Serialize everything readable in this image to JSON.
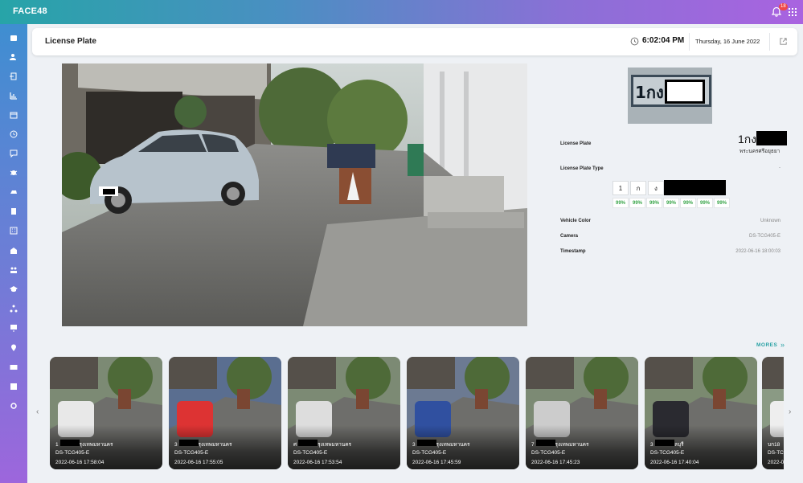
{
  "app": {
    "brand": "FACE48",
    "notification_count": "18"
  },
  "header": {
    "title": "License Plate",
    "time": "6:02:04 PM",
    "date": "Thursday, 16 June 2022"
  },
  "sidebar": {
    "items": [
      {
        "icon": "person-card-icon"
      },
      {
        "icon": "user-add-icon"
      },
      {
        "icon": "login-icon"
      },
      {
        "icon": "bar-chart-icon"
      },
      {
        "icon": "calendar-icon"
      },
      {
        "icon": "clock-icon"
      },
      {
        "icon": "message-icon"
      },
      {
        "icon": "bug-icon"
      },
      {
        "icon": "car-icon"
      },
      {
        "icon": "document-icon"
      },
      {
        "icon": "building-icon"
      },
      {
        "icon": "city-icon"
      },
      {
        "icon": "people-icon"
      },
      {
        "icon": "graduation-icon"
      },
      {
        "icon": "sitemap-icon"
      },
      {
        "icon": "monitor-icon"
      },
      {
        "icon": "location-pin-icon"
      },
      {
        "icon": "id-card-icon"
      },
      {
        "icon": "report-icon"
      },
      {
        "icon": "settings-icon"
      }
    ]
  },
  "detail": {
    "plate_prefix": "1กง",
    "province": "พระนครศรีอยุธยา",
    "labels": {
      "license_plate": "License Plate",
      "license_plate_type": "License Plate Type",
      "vehicle_color": "Vehicle Color",
      "camera": "Camera",
      "timestamp": "Timestamp"
    },
    "license_plate_type": "-",
    "vehicle_color": "Unknown",
    "camera": "DS-TCG405-E",
    "timestamp": "2022-06-16 18:00:03",
    "characters": [
      "1",
      "ก",
      "ง"
    ],
    "confidences": [
      "99%",
      "99%",
      "99%",
      "99%",
      "99%",
      "99%",
      "99%"
    ]
  },
  "mores_label": "MORES",
  "history": [
    {
      "plate_prefix": "1",
      "province": "กรุงเทพมหานคร",
      "camera": "DS-TCG405-E",
      "time": "2022-06-16 17:58:04"
    },
    {
      "plate_prefix": "3",
      "province": "กรุงเทพมหานคร",
      "camera": "DS-TCG405-E",
      "time": "2022-06-16 17:55:05"
    },
    {
      "plate_prefix": "ศ",
      "province": "กรุงเทพมหานคร",
      "camera": "DS-TCG405-E",
      "time": "2022-06-16 17:53:54"
    },
    {
      "plate_prefix": "3",
      "province": "กรุงเทพมหานคร",
      "camera": "DS-TCG405-E",
      "time": "2022-06-16 17:45:59"
    },
    {
      "plate_prefix": "7",
      "province": "กรุงเทพมหานคร",
      "camera": "DS-TCG405-E",
      "time": "2022-06-16 17:45:23"
    },
    {
      "plate_prefix": "3",
      "province": "ชลบุรี",
      "camera": "DS-TCG405-E",
      "time": "2022-06-16 17:40:04"
    },
    {
      "plate_prefix": "บก18",
      "province": "",
      "camera": "DS-TC",
      "time": "2022-0"
    }
  ],
  "colors": {
    "accent": "#2aa2a5",
    "confidence": "#3aa64a",
    "gradient_start": "#27a4a8",
    "gradient_end": "#a963e0"
  }
}
